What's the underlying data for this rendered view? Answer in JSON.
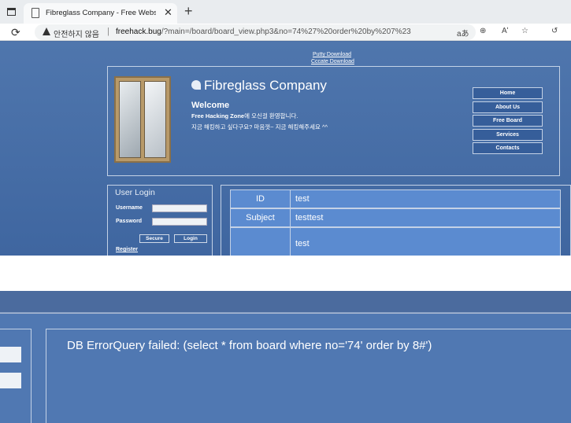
{
  "browser": {
    "tab_title": "Fibreglass Company - Free Website",
    "tab_close": "✕",
    "new_tab": "+",
    "reload": "⟳",
    "security_text": "안전하지 않음",
    "separator": "|",
    "url_domain": "freehack.bug",
    "url_path": "/?main=/board/board_view.php3&no=74%27%20order%20by%207%23",
    "tools": [
      "aあ",
      "⊕",
      "Aʹ",
      "☆",
      "↺"
    ]
  },
  "top_links": [
    "Putty Download",
    "Cccate Download"
  ],
  "header": {
    "brand": "Fibreglass Company",
    "welcome": "Welcome",
    "intro_bold": "Free Hacking Zone",
    "intro_rest": "에 오신걸 환영합니다.",
    "intro_line2": "지금 해킹하고 싶다구요? 마음껏~ 지금 해킹해주세요 ^^"
  },
  "nav": [
    "Home",
    "About Us",
    "Free Board",
    "Services",
    "Contacts"
  ],
  "login": {
    "title": "User Login",
    "username_label": "Username",
    "password_label": "Password",
    "secure_button": "Secure",
    "login_button": "Login",
    "register_link": "Register"
  },
  "board": {
    "rows": [
      {
        "label": "ID",
        "value": "test"
      },
      {
        "label": "Subject",
        "value": "testtest"
      },
      {
        "label": "",
        "value": "test"
      }
    ]
  },
  "error": {
    "message": "DB ErrorQuery failed: (select * from board where no='74' order by 8#')"
  },
  "colors": {
    "page_bg": "#4a6fa5",
    "row_bg": "#5b8bd0",
    "border": "#c4d2e6"
  }
}
